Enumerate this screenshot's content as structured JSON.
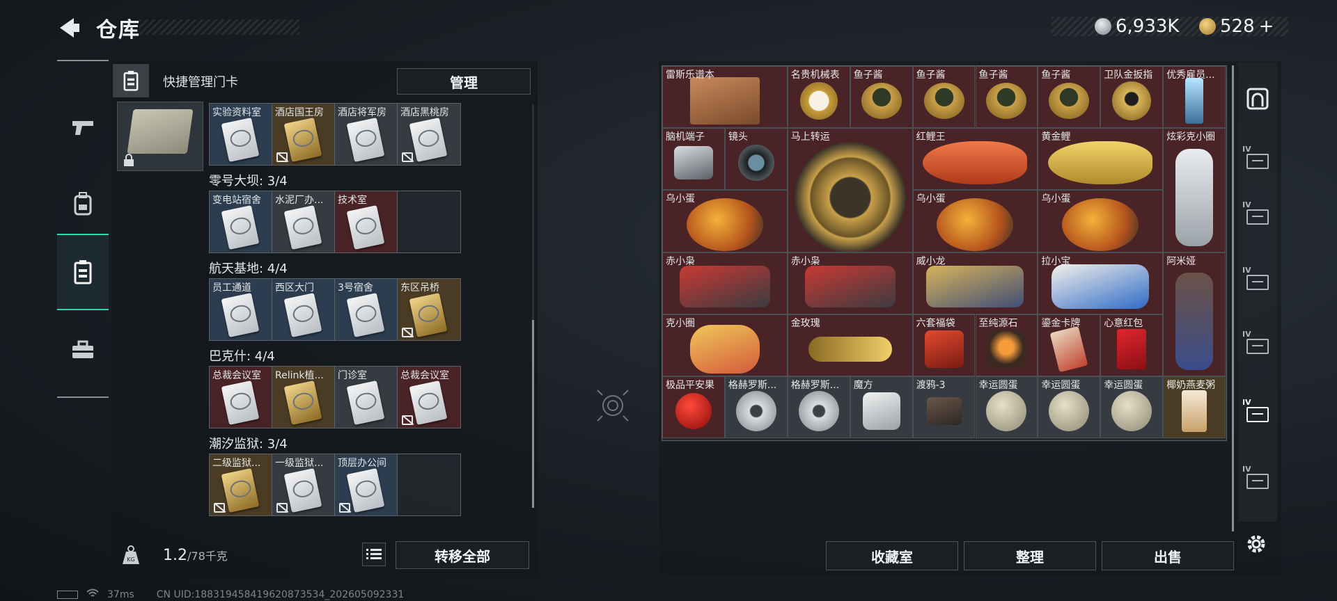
{
  "header": {
    "title": "仓库"
  },
  "currency": [
    {
      "icon": "silver-coin-icon",
      "value": "6,933K"
    },
    {
      "icon": "gold-coin-icon",
      "value": "528",
      "suffix": "+"
    }
  ],
  "left_rail": [
    {
      "icon": "pistol-icon",
      "active": false
    },
    {
      "icon": "backpack-icon",
      "active": false
    },
    {
      "icon": "keycard-icon",
      "active": true
    },
    {
      "icon": "toolbox-icon",
      "active": false
    }
  ],
  "keycard_panel": {
    "title": "快捷管理门卡",
    "manage_label": "管理",
    "groups": [
      {
        "title": "",
        "cards": [
          {
            "label": "实验资料室",
            "color": "blue",
            "locked": false
          },
          {
            "label": "酒店国王房",
            "color": "gold",
            "locked": true
          },
          {
            "label": "酒店将军房",
            "color": "gray",
            "locked": false
          },
          {
            "label": "酒店黑桃房",
            "color": "gray",
            "locked": true
          }
        ]
      },
      {
        "title": "零号大坝: 3/4",
        "cards": [
          {
            "label": "变电站宿舍",
            "color": "blue",
            "locked": false
          },
          {
            "label": "水泥厂办...",
            "color": "gray",
            "locked": false
          },
          {
            "label": "技术室",
            "color": "red",
            "locked": false
          },
          {
            "label": "",
            "color": "empty",
            "locked": false
          }
        ]
      },
      {
        "title": "航天基地: 4/4",
        "cards": [
          {
            "label": "员工通道",
            "color": "blue",
            "locked": false
          },
          {
            "label": "西区大门",
            "color": "blue",
            "locked": false
          },
          {
            "label": "3号宿舍",
            "color": "blue",
            "locked": false
          },
          {
            "label": "东区吊桥",
            "color": "gold",
            "locked": true
          }
        ]
      },
      {
        "title": "巴克什: 4/4",
        "cards": [
          {
            "label": "总裁会议室",
            "color": "red",
            "locked": false
          },
          {
            "label": "Relink植...",
            "color": "gold",
            "locked": false
          },
          {
            "label": "门诊室",
            "color": "gray",
            "locked": false
          },
          {
            "label": "总裁会议室",
            "color": "red",
            "locked": true
          }
        ]
      },
      {
        "title": "潮汐监狱: 3/4",
        "cards": [
          {
            "label": "二级监狱...",
            "color": "gold",
            "locked": true
          },
          {
            "label": "一级监狱...",
            "color": "gray",
            "locked": true
          },
          {
            "label": "顶层办公间",
            "color": "blue",
            "locked": true
          },
          {
            "label": "",
            "color": "empty",
            "locked": false
          }
        ]
      }
    ]
  },
  "bottom_left": {
    "weight_current": "1.2",
    "weight_max": "/78千克",
    "transfer_label": "转移全部"
  },
  "status": {
    "ping": "37ms",
    "uid": "CN UID:18831945841962087​3534_202605092331"
  },
  "grid_items": [
    {
      "label": "雷斯乐谱本",
      "art": "book",
      "bg": "red",
      "col": 0,
      "row": 0,
      "w": 2,
      "h": 1
    },
    {
      "label": "名贵机械表",
      "art": "watch",
      "bg": "red",
      "col": 2,
      "row": 0,
      "w": 1,
      "h": 1
    },
    {
      "label": "鱼子酱",
      "art": "caviar",
      "bg": "red",
      "col": 3,
      "row": 0,
      "w": 1,
      "h": 1
    },
    {
      "label": "鱼子酱",
      "art": "caviar",
      "bg": "red",
      "col": 4,
      "row": 0,
      "w": 1,
      "h": 1
    },
    {
      "label": "鱼子酱",
      "art": "caviar",
      "bg": "red",
      "col": 5,
      "row": 0,
      "w": 1,
      "h": 1
    },
    {
      "label": "鱼子酱",
      "art": "caviar",
      "bg": "red",
      "col": 6,
      "row": 0,
      "w": 1,
      "h": 1
    },
    {
      "label": "卫队金扳指",
      "art": "ring",
      "bg": "red",
      "col": 7,
      "row": 0,
      "w": 1,
      "h": 1
    },
    {
      "label": "优秀雇员...",
      "art": "crystal",
      "bg": "red",
      "col": 8,
      "row": 0,
      "w": 1,
      "h": 1
    },
    {
      "label": "脑机端子",
      "art": "terminal",
      "bg": "red",
      "col": 0,
      "row": 1,
      "w": 1,
      "h": 1
    },
    {
      "label": "镜头",
      "art": "lens",
      "bg": "red",
      "col": 1,
      "row": 1,
      "w": 1,
      "h": 1
    },
    {
      "label": "马上转运",
      "art": "wheel",
      "bg": "red",
      "col": 2,
      "row": 1,
      "w": 2,
      "h": 2
    },
    {
      "label": "红鲤王",
      "art": "koi",
      "bg": "red",
      "col": 4,
      "row": 1,
      "w": 2,
      "h": 1
    },
    {
      "label": "黄金鲤",
      "art": "carp",
      "bg": "red",
      "col": 6,
      "row": 1,
      "w": 2,
      "h": 1
    },
    {
      "label": "炫彩克小圈",
      "art": "doll",
      "bg": "red",
      "col": 8,
      "row": 1,
      "w": 1,
      "h": 2
    },
    {
      "label": "乌小蛋",
      "art": "egg",
      "bg": "red",
      "col": 0,
      "row": 2,
      "w": 2,
      "h": 1
    },
    {
      "label": "乌小蛋",
      "art": "egg",
      "bg": "red",
      "col": 4,
      "row": 2,
      "w": 2,
      "h": 1
    },
    {
      "label": "乌小蛋",
      "art": "egg",
      "bg": "red",
      "col": 6,
      "row": 2,
      "w": 2,
      "h": 1
    },
    {
      "label": "赤小枭",
      "art": "mech",
      "bg": "red",
      "col": 0,
      "row": 3,
      "w": 2,
      "h": 1
    },
    {
      "label": "赤小枭",
      "art": "mech",
      "bg": "red",
      "col": 2,
      "row": 3,
      "w": 2,
      "h": 1
    },
    {
      "label": "威小龙",
      "art": "dragon",
      "bg": "red",
      "col": 4,
      "row": 3,
      "w": 2,
      "h": 1
    },
    {
      "label": "拉小宝",
      "art": "lax",
      "bg": "red",
      "col": 6,
      "row": 3,
      "w": 2,
      "h": 1
    },
    {
      "label": "阿米娅",
      "art": "amiya",
      "bg": "red",
      "col": 8,
      "row": 3,
      "w": 1,
      "h": 2
    },
    {
      "label": "克小圈",
      "art": "clown",
      "bg": "red",
      "col": 0,
      "row": 4,
      "w": 2,
      "h": 1
    },
    {
      "label": "金玫瑰",
      "art": "rose",
      "bg": "red",
      "col": 2,
      "row": 4,
      "w": 2,
      "h": 1
    },
    {
      "label": "六套福袋",
      "art": "bag",
      "bg": "red",
      "col": 4,
      "row": 4,
      "w": 1,
      "h": 1
    },
    {
      "label": "至纯源石",
      "art": "ore",
      "bg": "red",
      "col": 5,
      "row": 4,
      "w": 1,
      "h": 1
    },
    {
      "label": "鎏金卡牌",
      "art": "cardw",
      "bg": "red",
      "col": 6,
      "row": 4,
      "w": 1,
      "h": 1
    },
    {
      "label": "心意红包",
      "art": "envelope",
      "bg": "red",
      "col": 7,
      "row": 4,
      "w": 1,
      "h": 1
    },
    {
      "label": "极品平安果",
      "art": "apple",
      "bg": "red",
      "col": 0,
      "row": 5,
      "w": 1,
      "h": 1
    },
    {
      "label": "格赫罗斯...",
      "art": "medal",
      "bg": "gray",
      "col": 1,
      "row": 5,
      "w": 1,
      "h": 1
    },
    {
      "label": "格赫罗斯...",
      "art": "medal",
      "bg": "gray",
      "col": 2,
      "row": 5,
      "w": 1,
      "h": 1
    },
    {
      "label": "魔方",
      "art": "cube",
      "bg": "gray",
      "col": 3,
      "row": 5,
      "w": 1,
      "h": 1
    },
    {
      "label": "渡鸦-3",
      "art": "tape",
      "bg": "gray",
      "col": 4,
      "row": 5,
      "w": 1,
      "h": 1
    },
    {
      "label": "幸运圆蛋",
      "art": "egglucky",
      "bg": "gray",
      "col": 5,
      "row": 5,
      "w": 1,
      "h": 1
    },
    {
      "label": "幸运圆蛋",
      "art": "egglucky",
      "bg": "gray",
      "col": 6,
      "row": 5,
      "w": 1,
      "h": 1
    },
    {
      "label": "幸运圆蛋",
      "art": "egglucky",
      "bg": "gray",
      "col": 7,
      "row": 5,
      "w": 1,
      "h": 1
    },
    {
      "label": "椰奶燕麦粥",
      "art": "oat",
      "bg": "gold",
      "col": 8,
      "row": 5,
      "w": 1,
      "h": 1
    }
  ],
  "right_buttons": {
    "collect": "收藏室",
    "sort": "整理",
    "sell": "出售"
  },
  "storage_pages": [
    {
      "icon": "safe-box-icon",
      "level": "",
      "active": false
    },
    {
      "icon": "storage-page-icon",
      "level": "IV",
      "active": false
    },
    {
      "icon": "storage-page-icon",
      "level": "IV",
      "active": false
    },
    {
      "icon": "storage-page-icon",
      "level": "IV",
      "active": false
    },
    {
      "icon": "storage-page-icon",
      "level": "IV",
      "active": false
    },
    {
      "icon": "storage-page-icon",
      "level": "IV",
      "active": true
    },
    {
      "icon": "storage-page-icon",
      "level": "IV",
      "active": false
    }
  ]
}
